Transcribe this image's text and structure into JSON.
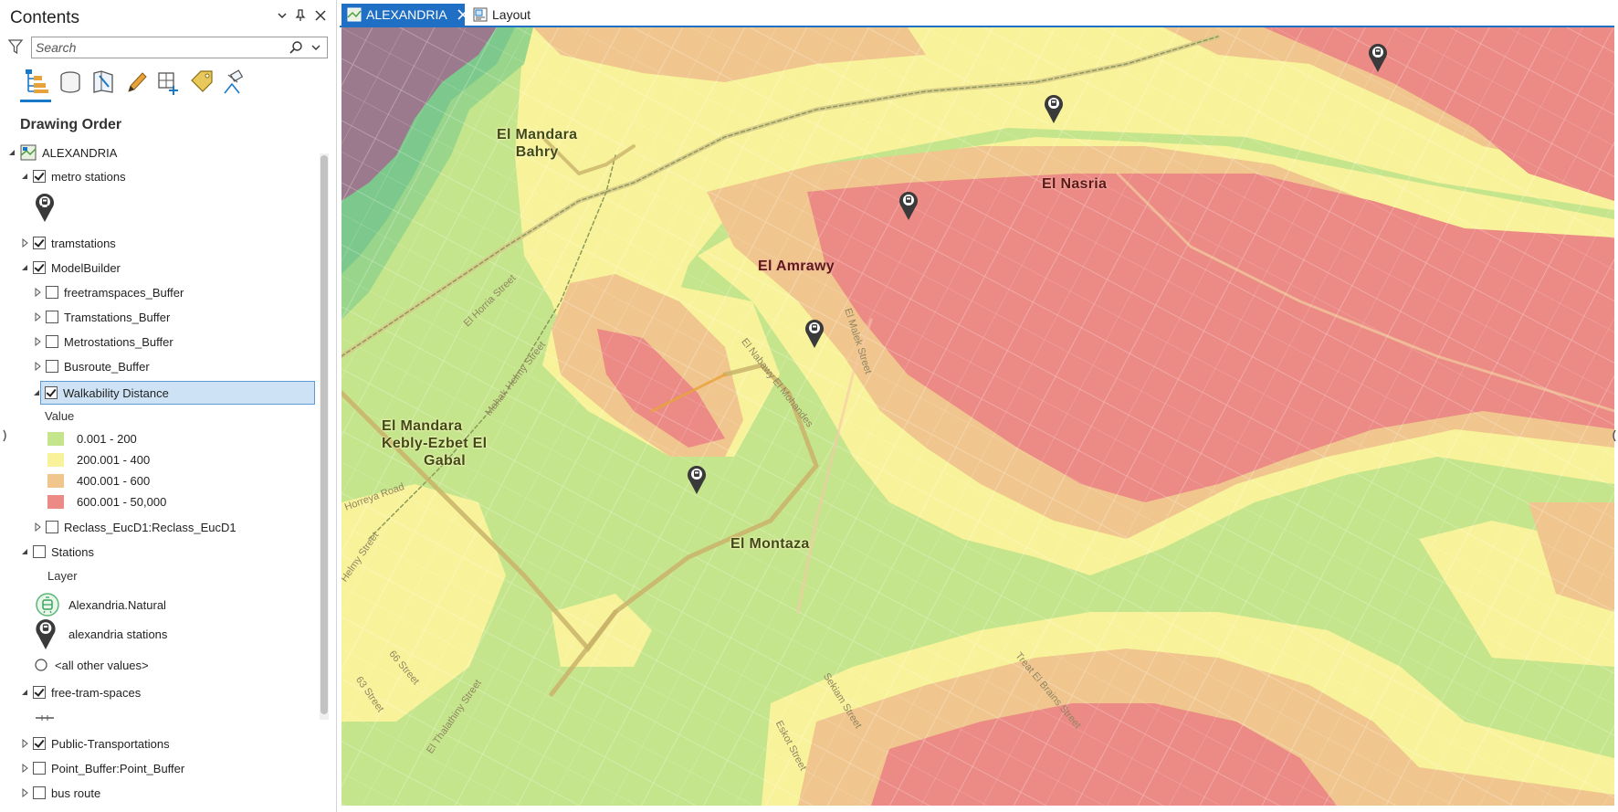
{
  "contents": {
    "title": "Contents",
    "search_placeholder": "Search",
    "section_label": "Drawing Order",
    "map_name": "ALEXANDRIA",
    "toolbar_icons": [
      "list-by-drawing-order-icon",
      "list-by-data-source-icon",
      "list-by-selection-icon",
      "list-by-editing-icon",
      "list-by-snapping-icon",
      "list-by-labeling-icon",
      "list-by-perspective-imagery-icon"
    ],
    "layers": {
      "metro_stations": "metro stations",
      "tramstations": "tramstations",
      "modelbuilder": "ModelBuilder",
      "freetramspaces_buffer": "freetramspaces_Buffer",
      "tramstations_buffer": "Tramstations_Buffer",
      "metrostations_buffer": "Metrostations_Buffer",
      "busroute_buffer": "Busroute_Buffer",
      "walkability_distance": "Walkability Distance",
      "reclass": "Reclass_EucD1:Reclass_EucD1",
      "stations": "Stations",
      "free_tram_spaces": "free-tram-spaces",
      "public_transportations": "Public-Transportations",
      "point_buffer": "Point_Buffer:Point_Buffer",
      "bus_route": "bus route"
    },
    "walkability_legend": {
      "field": "Value",
      "classes": [
        {
          "label": "0.001 - 200",
          "color": "#c5e58c"
        },
        {
          "label": "200.001 - 400",
          "color": "#f8f39a"
        },
        {
          "label": "400.001 - 600",
          "color": "#f0c68e"
        },
        {
          "label": "600.001 - 50,000",
          "color": "#ec8a86"
        }
      ]
    },
    "stations_legend": {
      "field": "Layer",
      "items": [
        "Alexandria.Natural",
        "alexandria stations",
        "<all other values>"
      ]
    }
  },
  "tabs": [
    {
      "label": "ALEXANDRIA",
      "active": true
    },
    {
      "label": "Layout",
      "active": false
    }
  ],
  "map": {
    "labels": {
      "mandara_bahry": [
        "El Mandara",
        "Bahry"
      ],
      "nasria": "El Nasria",
      "amrawy": "El Amrawy",
      "mandara_kebly": [
        "El Mandara",
        "Kebly-Ezbet El",
        "Gabal"
      ],
      "montaza": "El Montaza"
    },
    "streets": {
      "horria": "El Horria Street",
      "helmy": "Mahak Helmy Street",
      "nabawy": "El Nabawy El Mohandes",
      "malek": "El Malek Street",
      "s66": "66 Street",
      "s63": "63 Street",
      "thalathiny": "El Thalathiny Street",
      "sekiam": "Sekiam Street",
      "eskot": "Eskot Street",
      "treat": "Treat El Brains Street",
      "horreya_road": "Horreya Road",
      "helmy2": "Helmy Street"
    }
  }
}
